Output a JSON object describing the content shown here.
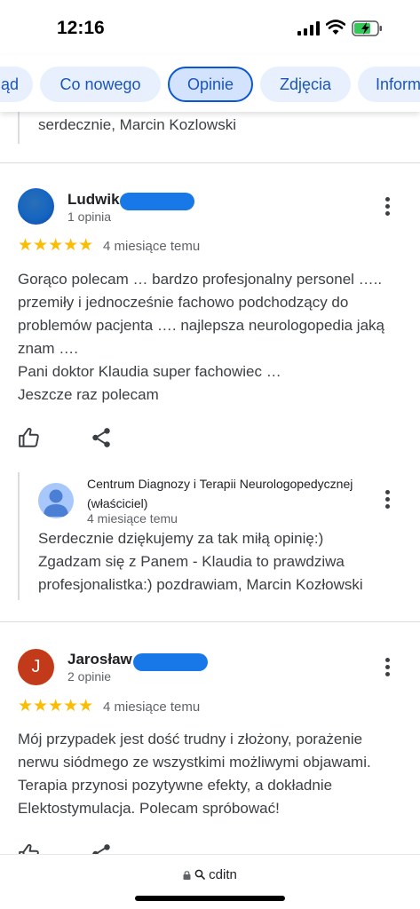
{
  "status_bar": {
    "time": "12:16"
  },
  "tabs": [
    {
      "label": "Przegląd",
      "active": false
    },
    {
      "label": "Co nowego",
      "active": false
    },
    {
      "label": "Opinie",
      "active": true
    },
    {
      "label": "Zdjęcia",
      "active": false
    },
    {
      "label": "Informacje",
      "active": false
    }
  ],
  "previous_reply": {
    "text": "serdecznie, Marcin Kozlowski"
  },
  "reviews": [
    {
      "author": "Ludwik P",
      "review_count": "1 opinia",
      "rating": 5,
      "stars": "★★★★★",
      "date": "4 miesiące temu",
      "text_lines": [
        "Gorąco polecam … bardzo profesjonalny personel …..",
        "przemiły i jednocześnie fachowo podchodzący do",
        "problemów pacjenta …. najlepsza neurologopedia jaką",
        "znam ….",
        "Pani doktor Klaudia super fachowiec …",
        "Jeszcze raz polecam"
      ],
      "owner_reply": {
        "name": "Centrum Diagnozy i Terapii Neurologopedycznej (właściciel)",
        "date": "4 miesiące temu",
        "text_lines": [
          "Serdecznie dziękujemy za tak miłą opinię:)",
          "Zgadzam się z Panem - Klaudia to prawdziwa",
          "profesjonalistka:) pozdrawiam, Marcin Kozłowski"
        ]
      }
    },
    {
      "author": "Jarosław",
      "avatar_letter": "J",
      "review_count": "2 opinie",
      "rating": 5,
      "stars": "★★★★★",
      "date": "4 miesiące temu",
      "text_lines": [
        "Mój przypadek jest dość trudny i złożony, porażenie",
        "nerwu siódmego ze wszystkimi możliwymi objawami.",
        "Terapia przynosi pozytywne efekty, a dokładnie",
        "Elektostymulacja. Polecam spróbować!"
      ]
    }
  ],
  "url_bar": {
    "text": "cditn"
  },
  "colors": {
    "accent": "#0b57d0",
    "tab_bg": "#e8f0fe",
    "star": "#fbbc04",
    "redaction": "#1878e8",
    "avatar_letter_bg": "#c23a19"
  },
  "icons": [
    "signal-icon",
    "wifi-icon",
    "battery-charging-icon",
    "more-vert-icon",
    "thumb-up-icon",
    "share-icon",
    "lock-icon",
    "search-icon"
  ]
}
